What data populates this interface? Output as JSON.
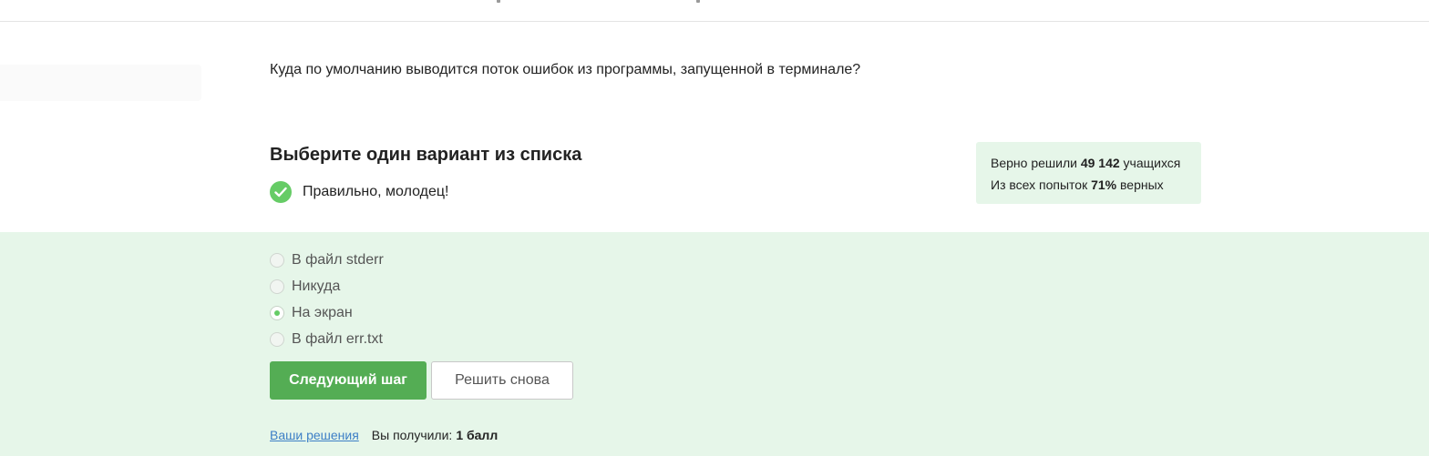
{
  "question": {
    "text": "Куда по умолчанию выводится поток ошибок из программы, запущенной в терминале?"
  },
  "choice": {
    "heading": "Выберите один вариант из списка",
    "feedback": "Правильно, молодец!"
  },
  "stats": {
    "solved_prefix": "Верно решили",
    "solved_count": "49 142",
    "solved_suffix": "учащихся",
    "attempts_prefix": "Из всех попыток",
    "attempts_percent": "71%",
    "attempts_suffix": "верных"
  },
  "options": [
    {
      "label": "В файл stderr",
      "selected": false
    },
    {
      "label": "Никуда",
      "selected": false
    },
    {
      "label": "На экран",
      "selected": true
    },
    {
      "label": "В файл err.txt",
      "selected": false
    }
  ],
  "buttons": {
    "next": "Следующий шаг",
    "retry": "Решить снова"
  },
  "footer": {
    "solutions_link": "Ваши решения",
    "score_label": "Вы получили:",
    "score_value": "1 балл"
  },
  "colors": {
    "accent_green": "#66cc66",
    "button_green": "#54ad54",
    "panel_green": "#e6f6e9",
    "link_blue": "#3d7fc6"
  },
  "icons": {
    "feedback": "check-circle-icon"
  }
}
